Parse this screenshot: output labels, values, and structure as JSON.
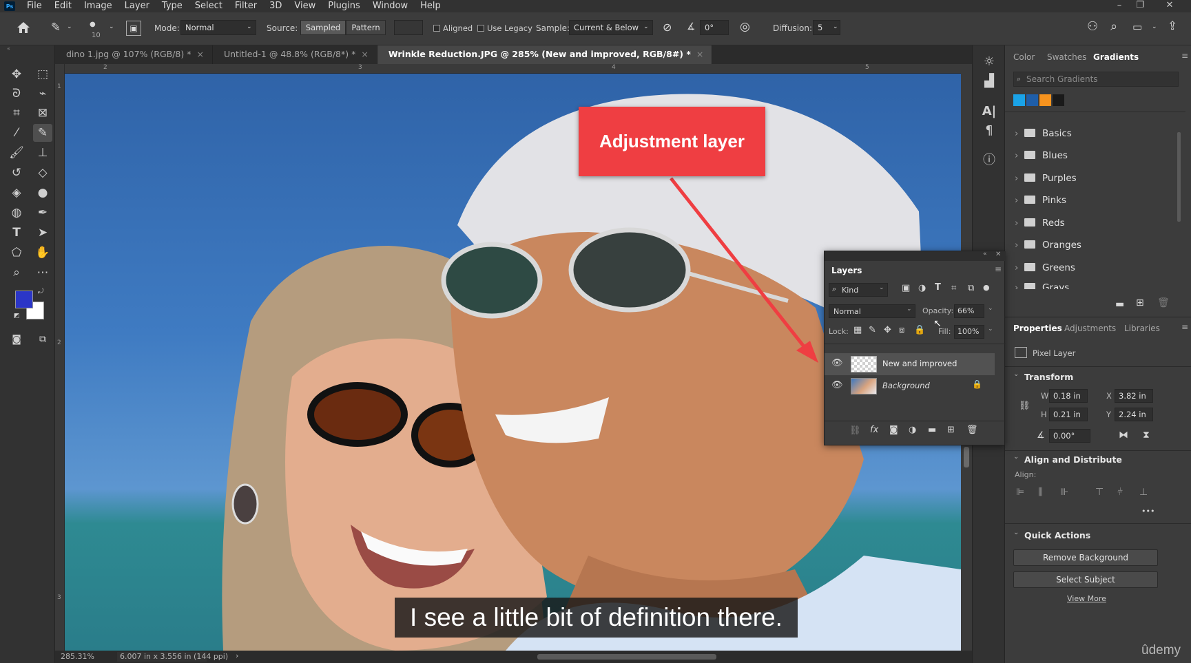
{
  "app": {
    "logo": "Ps"
  },
  "menu": [
    "File",
    "Edit",
    "Image",
    "Layer",
    "Type",
    "Select",
    "Filter",
    "3D",
    "View",
    "Plugins",
    "Window",
    "Help"
  ],
  "window_controls": {
    "minimize": "–",
    "restore": "❐",
    "close": "✕"
  },
  "options_bar": {
    "brush_size": "10",
    "mode_label": "Mode:",
    "mode_value": "Normal",
    "source_label": "Source:",
    "source_sampled": "Sampled",
    "source_pattern": "Pattern",
    "aligned_label": "Aligned",
    "use_legacy_label": "Use Legacy",
    "sample_label": "Sample:",
    "sample_value": "Current & Below",
    "angle_value": "0°",
    "diffusion_label": "Diffusion:",
    "diffusion_value": "5"
  },
  "doc_tabs": [
    {
      "label": "dino 1.jpg @ 107% (RGB/8) *",
      "active": false
    },
    {
      "label": "Untitled-1 @ 48.8% (RGB/8*) *",
      "active": false
    },
    {
      "label": "Wrinkle Reduction.JPG @ 285% (New and improved, RGB/8#) *",
      "active": true
    }
  ],
  "tab_close": "×",
  "rulers": {
    "top": [
      "2",
      "3",
      "4",
      "5"
    ],
    "left": [
      "1",
      "2",
      "3"
    ]
  },
  "status": {
    "zoom": "285.31%",
    "doc_info": "6.007 in x 3.556 in (144 ppi)",
    "arrow": "›"
  },
  "colors": {
    "foreground": "#2b36c7",
    "background": "#ffffff",
    "callout": "#ef3e42",
    "accent_selected": "#4f4f4f"
  },
  "right_panel": {
    "tabs": [
      "Color",
      "Swatches",
      "Gradients"
    ],
    "active_tab": "Gradients",
    "search_placeholder": "Search Gradients",
    "presets": [
      "#1aa3e8",
      "#1f5ea8",
      "#f7931e",
      "#1a1a1a"
    ],
    "folders": [
      "Basics",
      "Blues",
      "Purples",
      "Pinks",
      "Reds",
      "Oranges",
      "Greens",
      "Grays"
    ]
  },
  "properties_panel": {
    "tabs": [
      "Properties",
      "Adjustments",
      "Libraries"
    ],
    "active_tab": "Properties",
    "layer_kind": "Pixel Layer",
    "transform_header": "Transform",
    "w_label": "W",
    "w_value": "0.18 in",
    "h_label": "H",
    "h_value": "0.21 in",
    "x_label": "X",
    "x_value": "3.82 in",
    "y_label": "Y",
    "y_value": "2.24 in",
    "angle_value": "0.00°",
    "align_header": "Align and Distribute",
    "align_label": "Align:",
    "more": "•••",
    "quick_actions_header": "Quick Actions",
    "remove_bg": "Remove Background",
    "select_subject": "Select Subject",
    "view_more": "View More"
  },
  "layers_panel": {
    "title": "Layers",
    "filter_kind": "Kind",
    "blend_mode": "Normal",
    "opacity_label": "Opacity:",
    "opacity_value": "66%",
    "lock_label": "Lock:",
    "fill_label": "Fill:",
    "fill_value": "100%",
    "layers": [
      {
        "name": "New and improved",
        "selected": true
      },
      {
        "name": "Background",
        "selected": false,
        "locked": true
      }
    ],
    "footer_fx": "fx"
  },
  "overlay": {
    "callout_text": "Adjustment layer",
    "caption": "I see a little bit of definition there.",
    "watermark": "ûdemy"
  }
}
